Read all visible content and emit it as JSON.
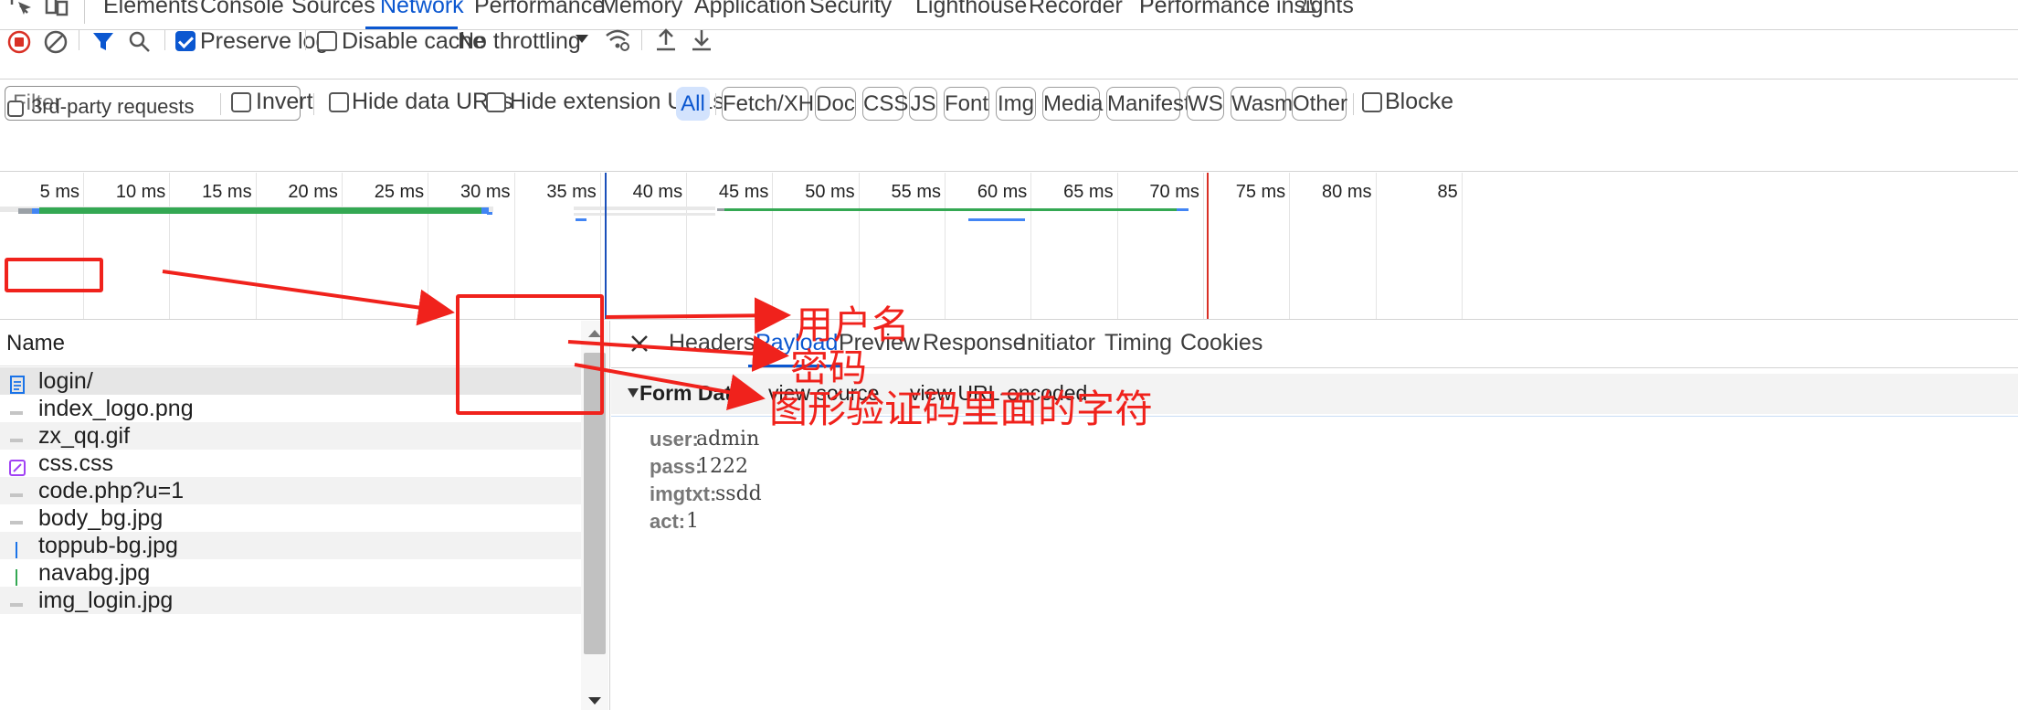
{
  "devtools": {
    "tabs": [
      "Elements",
      "Console",
      "Sources",
      "Network",
      "Performance",
      "Memory",
      "Application",
      "Security",
      "Lighthouse",
      "Recorder",
      "Performance insights"
    ],
    "active_tab": "Network"
  },
  "toolbar": {
    "preserve_log_label": "Preserve log",
    "preserve_log_checked": true,
    "disable_cache_label": "Disable cache",
    "disable_cache_checked": false,
    "throttling_value": "No throttling"
  },
  "filter": {
    "placeholder": "Filter",
    "invert_label": "Invert",
    "hide_data_urls_label": "Hide data URLs",
    "hide_extension_urls_label": "Hide extension URLs",
    "types": [
      "All",
      "Fetch/XHR",
      "Doc",
      "CSS",
      "JS",
      "Font",
      "Img",
      "Media",
      "Manifest",
      "WS",
      "Wasm",
      "Other"
    ],
    "active_type": "All",
    "blocked_label": "Blocke",
    "third_party_label": "3rd-party requests"
  },
  "timeline": {
    "ticks": [
      "5 ms",
      "10 ms",
      "15 ms",
      "20 ms",
      "25 ms",
      "30 ms",
      "35 ms",
      "40 ms",
      "45 ms",
      "50 ms",
      "55 ms",
      "60 ms",
      "65 ms",
      "70 ms",
      "75 ms",
      "80 ms",
      "85"
    ]
  },
  "requests": {
    "header": "Name",
    "items": [
      {
        "name": "login/",
        "icon": "document-icon"
      },
      {
        "name": "index_logo.png",
        "icon": "image-icon"
      },
      {
        "name": "zx_qq.gif",
        "icon": "image-icon"
      },
      {
        "name": "css.css",
        "icon": "stylesheet-icon"
      },
      {
        "name": "code.php?u=1",
        "icon": "image-icon"
      },
      {
        "name": "body_bg.jpg",
        "icon": "image-icon"
      },
      {
        "name": "toppub-bg.jpg",
        "icon": "image-icon"
      },
      {
        "name": "navabg.jpg",
        "icon": "image-icon"
      },
      {
        "name": "img_login.jpg",
        "icon": "image-icon"
      }
    ],
    "selected": "login/"
  },
  "details": {
    "tabs": [
      "Headers",
      "Payload",
      "Preview",
      "Response",
      "Initiator",
      "Timing",
      "Cookies"
    ],
    "active_tab": "Payload",
    "section_title": "Form Data",
    "view_source": "view source",
    "view_url_encoded": "view URL-encoded",
    "form_data": [
      {
        "key": "user:",
        "value": "admin"
      },
      {
        "key": "pass:",
        "value": "1222"
      },
      {
        "key": "imgtxt:",
        "value": "ssdd"
      },
      {
        "key": "act:",
        "value": "1"
      }
    ]
  },
  "annotations": {
    "username": "用户名",
    "password": "密码",
    "captcha": "图形验证码里面的字符",
    "color": "#f0221c"
  }
}
